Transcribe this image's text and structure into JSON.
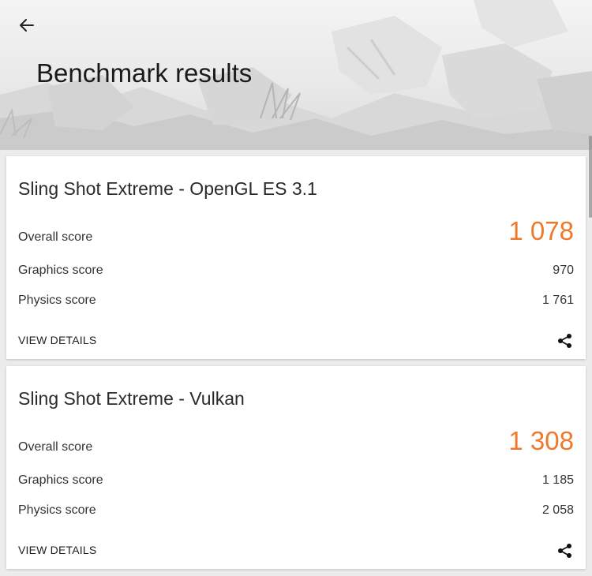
{
  "header": {
    "title": "Benchmark results",
    "back_icon": "arrow-left-icon"
  },
  "results": [
    {
      "title": "Sling Shot Extreme - OpenGL ES 3.1",
      "overall_label": "Overall score",
      "overall_value": "1 078",
      "graphics_label": "Graphics score",
      "graphics_value": "970",
      "physics_label": "Physics score",
      "physics_value": "1 761",
      "view_details": "VIEW DETAILS",
      "share_icon": "share-icon"
    },
    {
      "title": "Sling Shot Extreme - Vulkan",
      "overall_label": "Overall score",
      "overall_value": "1 308",
      "graphics_label": "Graphics score",
      "graphics_value": "1 185",
      "physics_label": "Physics score",
      "physics_value": "2 058",
      "view_details": "VIEW DETAILS",
      "share_icon": "share-icon"
    }
  ],
  "colors": {
    "accent": "#f0782a",
    "card_background": "#ffffff",
    "page_background": "#ececec"
  }
}
